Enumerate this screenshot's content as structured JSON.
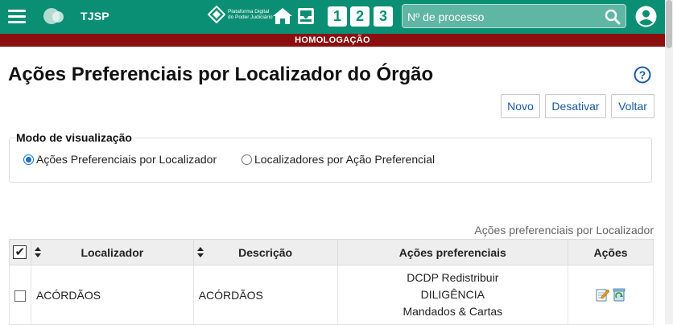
{
  "header": {
    "brand": "TJSP",
    "pdpj_text": "Plataforma Digital do Poder Judiciário",
    "quick_buttons": [
      "1",
      "2",
      "3"
    ],
    "search_placeholder": "Nº de processo"
  },
  "environment_banner": "HOMOLOGAÇÃO",
  "page": {
    "title": "Ações Preferenciais por Localizador do Órgão",
    "buttons": {
      "novo": "Novo",
      "desativar": "Desativar",
      "voltar": "Voltar"
    }
  },
  "view_mode": {
    "legend": "Modo de visualização",
    "options": [
      {
        "label": "Ações Preferenciais por Localizador",
        "selected": true
      },
      {
        "label": "Localizadores por Ação Preferencial",
        "selected": false
      }
    ]
  },
  "table": {
    "caption": "Ações preferenciais por Localizador",
    "columns": [
      "Localizador",
      "Descrição",
      "Ações preferenciais",
      "Ações"
    ],
    "rows": [
      {
        "localizador": "ACÓRDÃOS",
        "descricao": "ACÓRDÃOS",
        "acoes_preferenciais": [
          "DCDP Redistribuir",
          "DILIGÊNCIA",
          "Mandados & Cartas"
        ]
      }
    ]
  },
  "icons": {
    "menu": "hamburger-icon",
    "home": "home-icon",
    "inbox": "inbox-icon",
    "search": "search-icon",
    "user": "user-icon",
    "help": "help-icon",
    "edit": "edit-icon",
    "refresh": "recycle-icon"
  },
  "colors": {
    "header_bg": "#0b8f74",
    "banner_bg": "#8b0f0f",
    "link": "#1a5aa0"
  }
}
